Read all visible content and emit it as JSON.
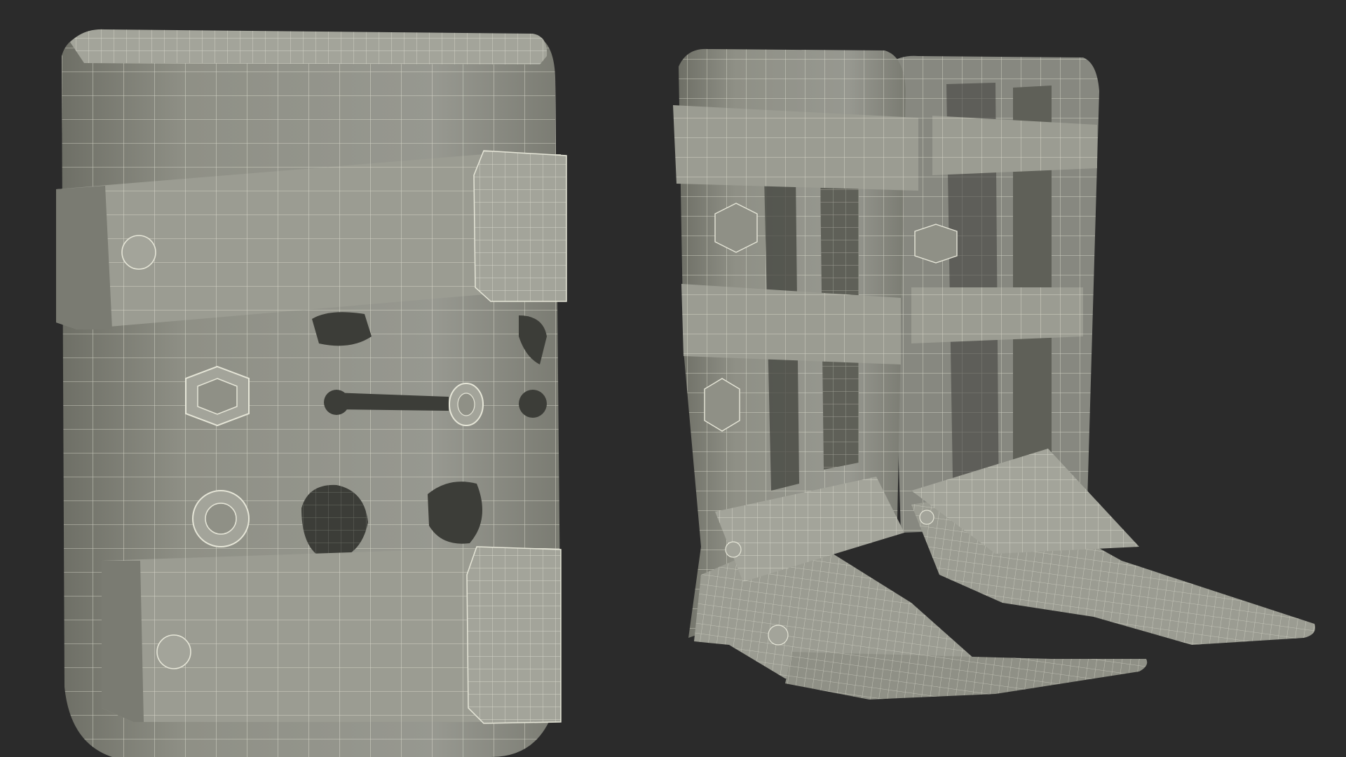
{
  "colors": {
    "background": "#2b2b2b",
    "shell": "#8f9086",
    "shell_light": "#a3a49a",
    "shell_dark": "#6e6f66",
    "hole": "#3c3d38",
    "wire": "#e6e6d8"
  },
  "render": {
    "style": "wireframe-over-clay",
    "subjects": [
      "ankle-foot-orthosis-closeup",
      "ankle-foot-orthosis-pair"
    ]
  }
}
